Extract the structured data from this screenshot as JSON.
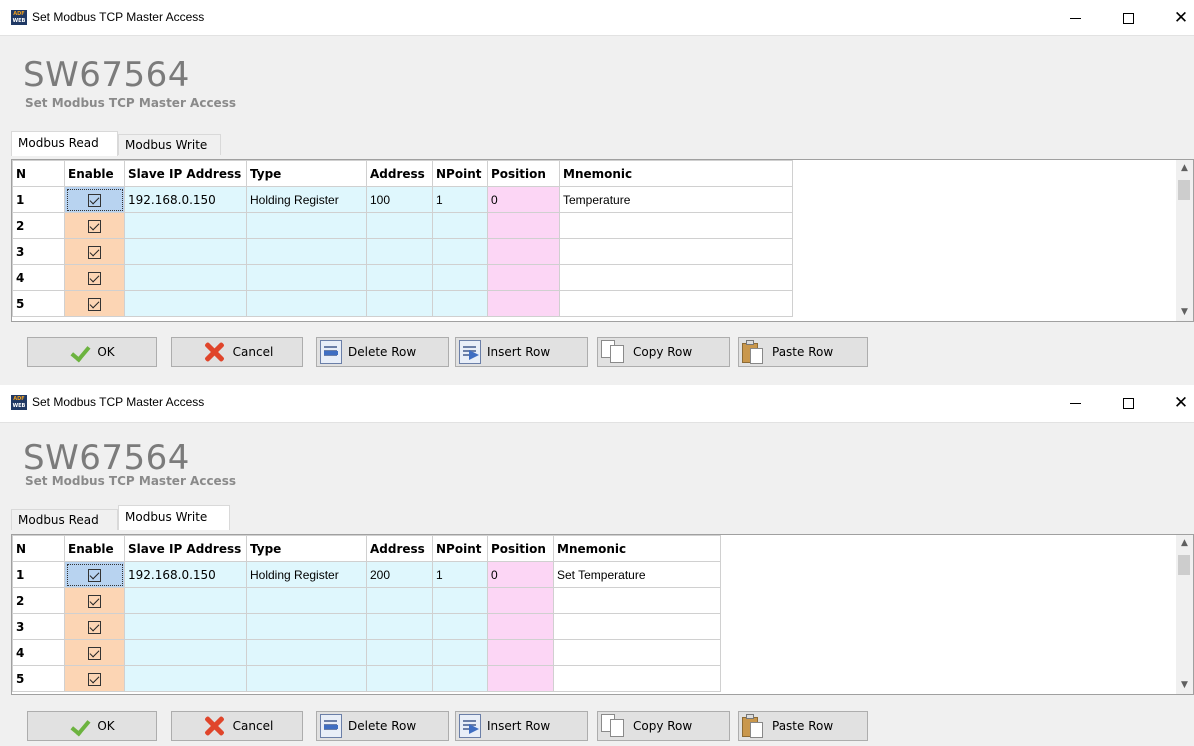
{
  "windows": [
    {
      "title": "Set Modbus TCP Master Access",
      "big_title": "SW67564",
      "sub_title": "Set Modbus TCP Master Access",
      "tabs": [
        "Modbus Read",
        "Modbus Write"
      ],
      "active_tab": "Modbus Read",
      "columns": [
        "N",
        "Enable",
        "Slave IP Address",
        "Type",
        "Address",
        "NPoint",
        "Position",
        "Mnemonic"
      ],
      "rows": [
        {
          "n": "1",
          "enable": true,
          "ip": "192.168.0.150",
          "type": "Holding Register",
          "address": "100",
          "npoint": "1",
          "position": "0",
          "mnemonic": "Temperature"
        },
        {
          "n": "2",
          "enable": true,
          "ip": "",
          "type": "",
          "address": "",
          "npoint": "",
          "position": "",
          "mnemonic": ""
        },
        {
          "n": "3",
          "enable": true,
          "ip": "",
          "type": "",
          "address": "",
          "npoint": "",
          "position": "",
          "mnemonic": ""
        },
        {
          "n": "4",
          "enable": true,
          "ip": "",
          "type": "",
          "address": "",
          "npoint": "",
          "position": "",
          "mnemonic": ""
        },
        {
          "n": "5",
          "enable": true,
          "ip": "",
          "type": "",
          "address": "",
          "npoint": "",
          "position": "",
          "mnemonic": ""
        }
      ],
      "buttons": {
        "ok": "OK",
        "cancel": "Cancel",
        "delete_row": "Delete Row",
        "insert_row": "Insert Row",
        "copy_row": "Copy Row",
        "paste_row": "Paste Row"
      }
    },
    {
      "title": "Set Modbus TCP Master Access",
      "big_title": "SW67564",
      "sub_title": "Set Modbus TCP Master Access",
      "tabs": [
        "Modbus Read",
        "Modbus Write"
      ],
      "active_tab": "Modbus Write",
      "columns": [
        "N",
        "Enable",
        "Slave IP Address",
        "Type",
        "Address",
        "NPoint",
        "Position",
        "Mnemonic"
      ],
      "rows": [
        {
          "n": "1",
          "enable": true,
          "ip": "192.168.0.150",
          "type": "Holding Register",
          "address": "200",
          "npoint": "1",
          "position": "0",
          "mnemonic": "Set Temperature"
        },
        {
          "n": "2",
          "enable": true,
          "ip": "",
          "type": "",
          "address": "",
          "npoint": "",
          "position": "",
          "mnemonic": ""
        },
        {
          "n": "3",
          "enable": true,
          "ip": "",
          "type": "",
          "address": "",
          "npoint": "",
          "position": "",
          "mnemonic": ""
        },
        {
          "n": "4",
          "enable": true,
          "ip": "",
          "type": "",
          "address": "",
          "npoint": "",
          "position": "",
          "mnemonic": ""
        },
        {
          "n": "5",
          "enable": true,
          "ip": "",
          "type": "",
          "address": "",
          "npoint": "",
          "position": "",
          "mnemonic": ""
        }
      ],
      "buttons": {
        "ok": "OK",
        "cancel": "Cancel",
        "delete_row": "Delete Row",
        "insert_row": "Insert Row",
        "copy_row": "Copy Row",
        "paste_row": "Paste Row"
      }
    }
  ],
  "colors": {
    "enable_cell": "#fcd5b4",
    "data_cell": "#dff7fd",
    "position_cell": "#fcd6f5",
    "selected_enable": "#b8d3f0",
    "title_gray": "#7b7b7b"
  },
  "icons": {
    "app": "adfweb-app-icon",
    "ok": "green-check-icon",
    "cancel": "red-x-icon",
    "delete_row": "delete-row-icon",
    "insert_row": "insert-row-icon",
    "copy_row": "copy-icon",
    "paste_row": "paste-icon"
  }
}
